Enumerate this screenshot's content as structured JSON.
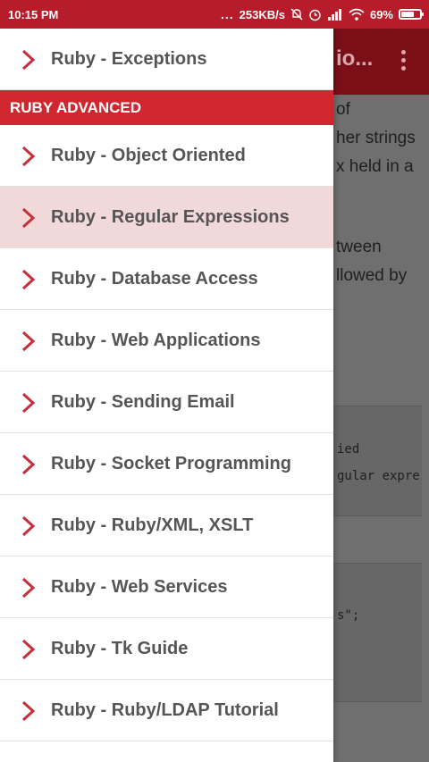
{
  "status_bar": {
    "time": "10:15 PM",
    "dots": "...",
    "network_speed": "253KB/s",
    "battery_percent": "69%",
    "battery_level": 0.69,
    "icons": [
      "mute-icon",
      "alarm-icon",
      "signal-icon",
      "wifi-icon",
      "battery-icon"
    ]
  },
  "app_bar": {
    "title_partial": "io..."
  },
  "article": {
    "lines": [
      "of",
      "her strings",
      "x held in a",
      "tween",
      "llowed by"
    ],
    "code_block_1": [
      "ied",
      "gular expre"
    ],
    "code_block_2": [
      "s\";"
    ]
  },
  "drawer": {
    "accent_color": "#d0262f",
    "top_item": {
      "label": "Ruby - Exceptions"
    },
    "section_header": "RUBY ADVANCED",
    "items": [
      {
        "label": "Ruby - Object Oriented",
        "active": false
      },
      {
        "label": "Ruby - Regular Expressions",
        "active": true
      },
      {
        "label": "Ruby - Database Access",
        "active": false
      },
      {
        "label": "Ruby - Web Applications",
        "active": false
      },
      {
        "label": "Ruby - Sending Email",
        "active": false
      },
      {
        "label": "Ruby - Socket Programming",
        "active": false
      },
      {
        "label": "Ruby - Ruby/XML, XSLT",
        "active": false
      },
      {
        "label": "Ruby - Web Services",
        "active": false
      },
      {
        "label": "Ruby - Tk Guide",
        "active": false
      },
      {
        "label": "Ruby - Ruby/LDAP Tutorial",
        "active": false
      }
    ]
  }
}
